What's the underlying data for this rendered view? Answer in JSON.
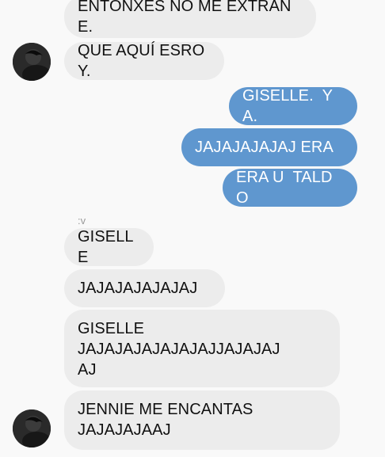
{
  "conversation": {
    "messages": [
      {
        "direction": "incoming",
        "text": "ENTONXES NO ME EXTRAÑE."
      },
      {
        "direction": "incoming",
        "text": "QUE AQUÍ ESROY."
      },
      {
        "direction": "outgoing",
        "text": "GISELLE.  YA."
      },
      {
        "direction": "outgoing",
        "text": "JAJAJAJAJAJ ERA"
      },
      {
        "direction": "outgoing",
        "text": "ERA U  TALDO"
      },
      {
        "direction": "incoming",
        "text": "GISELLE"
      },
      {
        "direction": "incoming",
        "text": "JAJAJAJAJAJAJ"
      },
      {
        "direction": "incoming",
        "text": "GISELLE\nJAJAJAJAJAJAJAJJAJAJAJ\nAJ"
      },
      {
        "direction": "incoming",
        "text": "JENNIE ME ENCANTAS\nJAJAJAJAAJ"
      }
    ],
    "sender_label": ":v"
  },
  "colors": {
    "background": "#f9f9f9",
    "incoming_bubble": "#ececec",
    "outgoing_bubble": "#5f97cf",
    "outgoing_text": "#ffffff"
  }
}
